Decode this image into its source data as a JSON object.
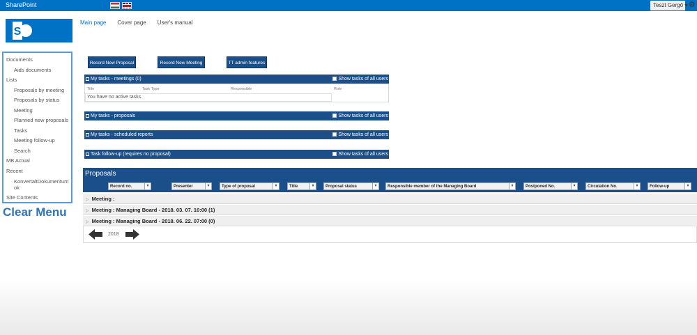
{
  "suite": {
    "title": "SharePoint",
    "user": "Teszt Gergő ▾"
  },
  "topnav": [
    "Main page",
    "Cover page",
    "User's manual"
  ],
  "quicklaunch": [
    {
      "label": "Documents",
      "sub": false
    },
    {
      "label": "Aids documents",
      "sub": true
    },
    {
      "label": "Lists",
      "sub": false
    },
    {
      "label": "Proposals by meeting",
      "sub": true
    },
    {
      "label": "Proposals by status",
      "sub": true
    },
    {
      "label": "Meeting",
      "sub": true
    },
    {
      "label": "Planned new proposals",
      "sub": true
    },
    {
      "label": "Tasks",
      "sub": true
    },
    {
      "label": "Meeting follow-up",
      "sub": true
    },
    {
      "label": "Search",
      "sub": true
    },
    {
      "label": "MB Actual",
      "sub": false
    },
    {
      "label": "Recent",
      "sub": false
    },
    {
      "label": "KonvertaltDokumentum ok",
      "sub": true
    },
    {
      "label": "Site Contents",
      "sub": false
    }
  ],
  "clear_menu": "Clear Menu",
  "buttons": {
    "record_proposal": "Record New Proposal",
    "record_meeting": "Record New Meeting",
    "admin": "TT admin features"
  },
  "panels": {
    "show_all": "Show tasks of all users",
    "meetings": "My tasks  - meetings (0)",
    "proposals": "My tasks  - proposals",
    "reports": "My tasks  - scheduled reports",
    "followup": "Task follow-up (requires no proposal)"
  },
  "task_table": {
    "columns": [
      "Title",
      "Task Type",
      "Responsible",
      "Role"
    ],
    "empty_message": "You have no active tasks."
  },
  "proposals": {
    "title": "Proposals",
    "filters": [
      "Record no.",
      "Presenter",
      "Type of proposal",
      "Title",
      "Proposal status",
      "Responsible member of the Managing Board",
      "Postponed No.",
      "Circulation No.",
      "Follow-up"
    ],
    "groups": [
      "Meeting :",
      "Meeting : Managing Board - 2018. 03. 07. 10:00 (1)",
      "Meeting : Managing Board - 2018. 06. 22. 07:00 (0)"
    ],
    "pager_label": "2018"
  },
  "colors": {
    "suite_blue": "#0072c6",
    "panel_navy": "#1a4f8a",
    "clear_menu": "#2e75b6"
  }
}
